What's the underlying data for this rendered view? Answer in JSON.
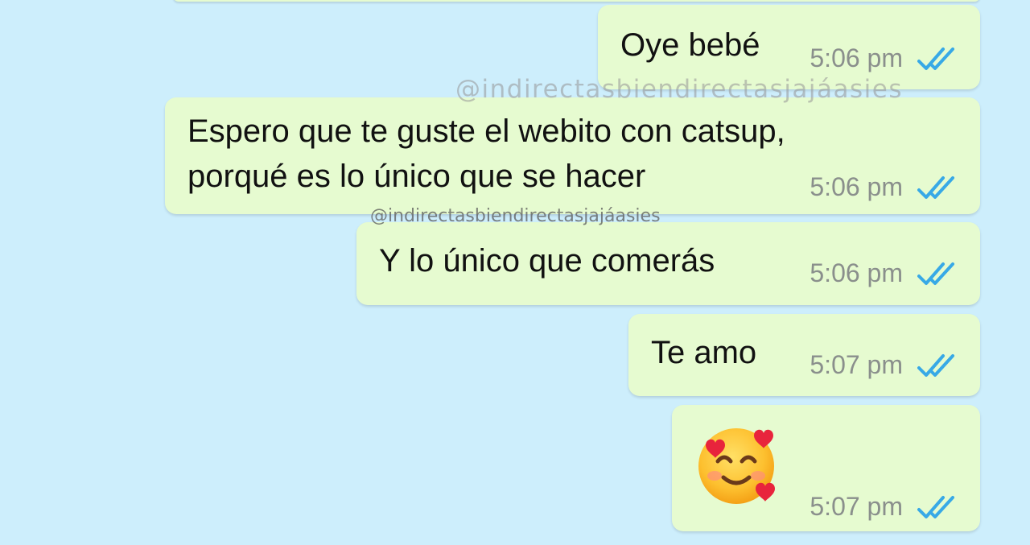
{
  "messages": [
    {
      "text": "Oye bebé",
      "time": "5:06 pm",
      "status": "read"
    },
    {
      "text": "Espero que te guste el webito con catsup,\nporqué es lo único que se hacer",
      "line1": "Espero que te guste el webito con catsup,",
      "line2": "porqué es lo único que se hacer",
      "time": "5:06 pm",
      "status": "read"
    },
    {
      "text": "Y lo único que comerás",
      "time": "5:06 pm",
      "status": "read"
    },
    {
      "text": "Te amo",
      "time": "5:07 pm",
      "status": "read"
    },
    {
      "emoji": "smiling-face-with-hearts",
      "time": "5:07 pm",
      "status": "read"
    }
  ],
  "watermarks": {
    "large": "@indirectasbiendirectasjajáasies",
    "small": "@indirectasbiendirectasjajáasies"
  },
  "colors": {
    "background": "#cdeefc",
    "bubble": "#e6fbd0",
    "time_text": "#8a8f8c",
    "read_ticks": "#38a9e6"
  }
}
